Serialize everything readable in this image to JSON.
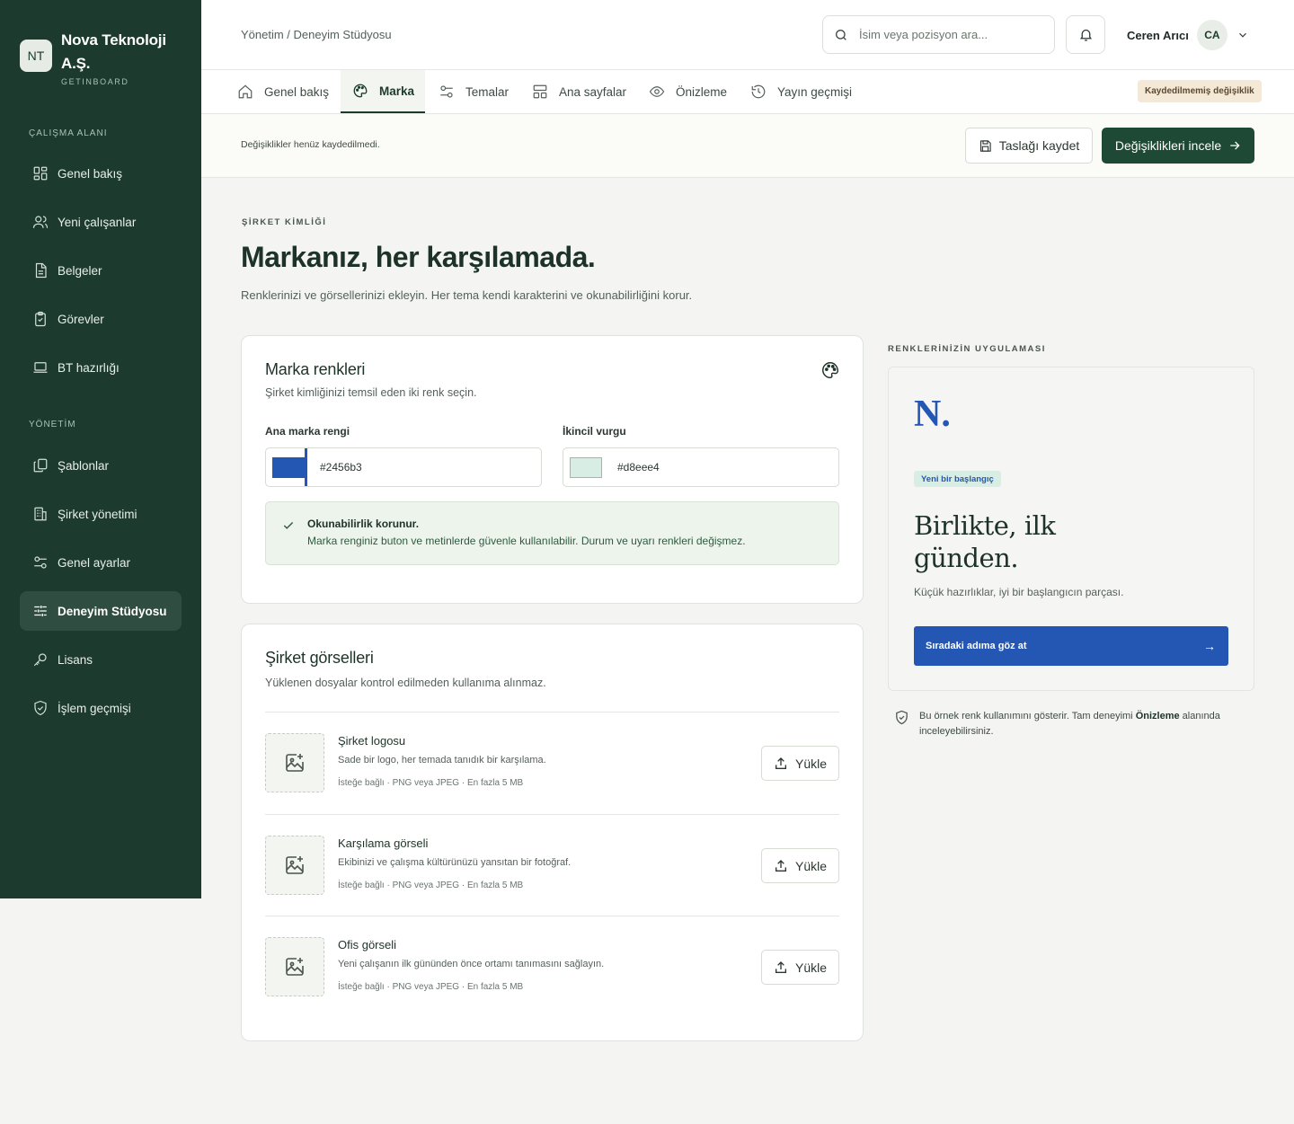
{
  "sidebar": {
    "brand_initials": "NT",
    "brand_name": "Nova Teknoloji A.Ş.",
    "brand_sub": "GETINBOARD",
    "section_workspace": "ÇALIŞMA ALANI",
    "section_admin": "YÖNETİM",
    "workspace_items": [
      {
        "label": "Genel bakış",
        "icon": "dashboard-icon"
      },
      {
        "label": "Yeni çalışanlar",
        "icon": "users-icon"
      },
      {
        "label": "Belgeler",
        "icon": "document-icon"
      },
      {
        "label": "Görevler",
        "icon": "clipboard-check-icon"
      },
      {
        "label": "BT hazırlığı",
        "icon": "laptop-icon"
      }
    ],
    "admin_items": [
      {
        "label": "Şablonlar",
        "icon": "copy-icon"
      },
      {
        "label": "Şirket yönetimi",
        "icon": "building-icon"
      },
      {
        "label": "Genel ayarlar",
        "icon": "sliders-icon"
      },
      {
        "label": "Deneyim Stüdyosu",
        "icon": "tune-icon",
        "active": true
      },
      {
        "label": "Lisans",
        "icon": "key-icon"
      },
      {
        "label": "İşlem geçmişi",
        "icon": "shield-check-icon"
      }
    ]
  },
  "header": {
    "breadcrumb": "Yönetim / Deneyim Stüdyosu",
    "search_placeholder": "İsim veya pozisyon ara...",
    "user_name": "Ceren Arıcı",
    "user_initials": "CA"
  },
  "tabs": [
    {
      "label": "Genel bakış",
      "icon": "home-icon"
    },
    {
      "label": "Marka",
      "icon": "palette-icon",
      "active": true
    },
    {
      "label": "Temalar",
      "icon": "sliders-icon"
    },
    {
      "label": "Ana sayfalar",
      "icon": "layout-icon"
    },
    {
      "label": "Önizleme",
      "icon": "eye-icon"
    },
    {
      "label": "Yayın geçmişi",
      "icon": "history-icon"
    }
  ],
  "unsaved_badge": "Kaydedilmemiş değişiklik",
  "actionbar": {
    "message": "Değişiklikler henüz kaydedilmedi.",
    "save_draft": "Taslağı kaydet",
    "review": "Değişiklikleri incele"
  },
  "page": {
    "eyebrow": "ŞİRKET KİMLİĞİ",
    "title": "Markanız, her karşılamada.",
    "lead": "Renklerinizi ve görsellerinizi ekleyin. Her tema kendi karakterini ve okunabilirliğini korur."
  },
  "colors_card": {
    "title": "Marka renkleri",
    "desc": "Şirket kimliğinizi temsil eden iki renk seçin.",
    "primary_label": "Ana marka rengi",
    "primary_value": "#2456b3",
    "secondary_label": "İkincil vurgu",
    "secondary_value": "#d8eee4",
    "notice_title": "Okunabilirlik korunur.",
    "notice_body": "Marka renginiz buton ve metinlerde güvenle kullanılabilir. Durum ve uyarı renkleri değişmez."
  },
  "assets_card": {
    "title": "Şirket görselleri",
    "desc": "Yüklenen dosyalar kontrol edilmeden kullanıma alınmaz.",
    "upload_label": "Yükle",
    "items": [
      {
        "name": "Şirket logosu",
        "desc": "Sade bir logo, her temada tanıdık bir karşılama.",
        "meta": "İsteğe bağlı · PNG veya JPEG · En fazla 5 MB"
      },
      {
        "name": "Karşılama görseli",
        "desc": "Ekibinizi ve çalışma kültürünüzü yansıtan bir fotoğraf.",
        "meta": "İsteğe bağlı · PNG veya JPEG · En fazla 5 MB"
      },
      {
        "name": "Ofis görseli",
        "desc": "Yeni çalışanın ilk gününden önce ortamı tanımasını sağlayın.",
        "meta": "İsteğe bağlı · PNG veya JPEG · En fazla 5 MB"
      }
    ]
  },
  "preview": {
    "eyebrow": "RENKLERİNİZİN UYGULAMASI",
    "logo": "N.",
    "pill": "Yeni bir başlangıç",
    "title": "Birlikte, ilk günden.",
    "subtitle": "Küçük hazırlıklar, iyi bir başlangıcın parçası.",
    "cta": "Sıradaki adıma göz at",
    "cta_arrow": "→",
    "footnote_pre": "Bu örnek renk kullanımını gösterir. Tam deneyimi ",
    "footnote_strong": "Önizleme",
    "footnote_post": " alanında inceleyebilirsiniz."
  },
  "colors": {
    "sidebar_bg": "#1c3a2d",
    "primary_button": "#1e4a35",
    "brand_primary": "#2456b3",
    "brand_secondary": "#d8eee4"
  }
}
